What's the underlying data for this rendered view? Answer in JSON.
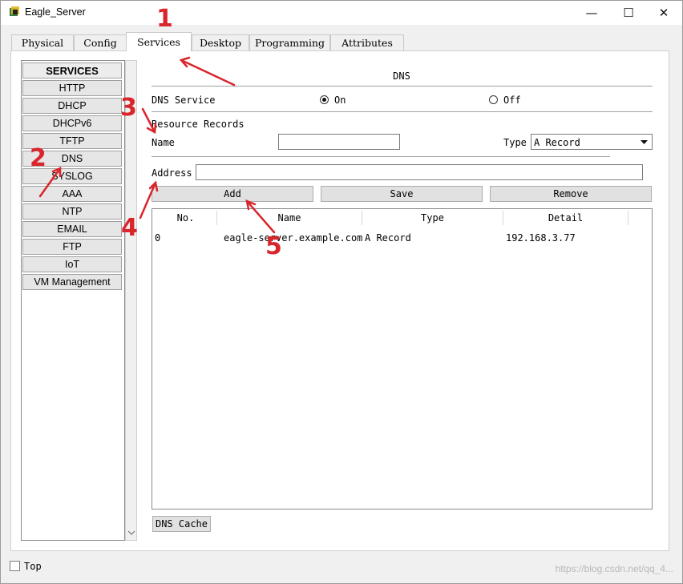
{
  "window": {
    "title": "Eagle_Server",
    "controls": {
      "minimize": "—",
      "maximize": "☐",
      "close": "✕"
    }
  },
  "tabs": [
    {
      "label": "Physical"
    },
    {
      "label": "Config"
    },
    {
      "label": "Services",
      "active": true
    },
    {
      "label": "Desktop"
    },
    {
      "label": "Programming"
    },
    {
      "label": "Attributes"
    }
  ],
  "services": {
    "header": "SERVICES",
    "items": [
      "HTTP",
      "DHCP",
      "DHCPv6",
      "TFTP",
      "DNS",
      "SYSLOG",
      "AAA",
      "NTP",
      "EMAIL",
      "FTP",
      "IoT",
      "VM Management"
    ],
    "selected": "DNS"
  },
  "dns": {
    "section_title": "DNS",
    "service_label": "DNS Service",
    "on_label": "On",
    "off_label": "Off",
    "service_state": "On",
    "records_label": "Resource Records",
    "name_label": "Name",
    "name_value": "",
    "type_label": "Type",
    "type_value": "A Record",
    "address_label": "Address",
    "address_value": "",
    "buttons": {
      "add": "Add",
      "save": "Save",
      "remove": "Remove"
    },
    "table": {
      "columns": [
        "No.",
        "Name",
        "Type",
        "Detail"
      ],
      "rows": [
        {
          "no": "0",
          "name": "eagle-server.example.com",
          "type": "A Record",
          "detail": "192.168.3.77"
        }
      ]
    },
    "cache_button": "DNS Cache"
  },
  "footer": {
    "top_label": "Top",
    "top_checked": false
  },
  "annotations": [
    "1",
    "2",
    "3",
    "4",
    "5"
  ],
  "watermark": "https://blog.csdn.net/qq_4...",
  "colors": {
    "annotation_red": "#d9262c"
  },
  "icons": {
    "app": "packet-tracer-server-icon",
    "dropdown": "chevron-down-icon",
    "scroll_down": "chevron-down-icon"
  }
}
